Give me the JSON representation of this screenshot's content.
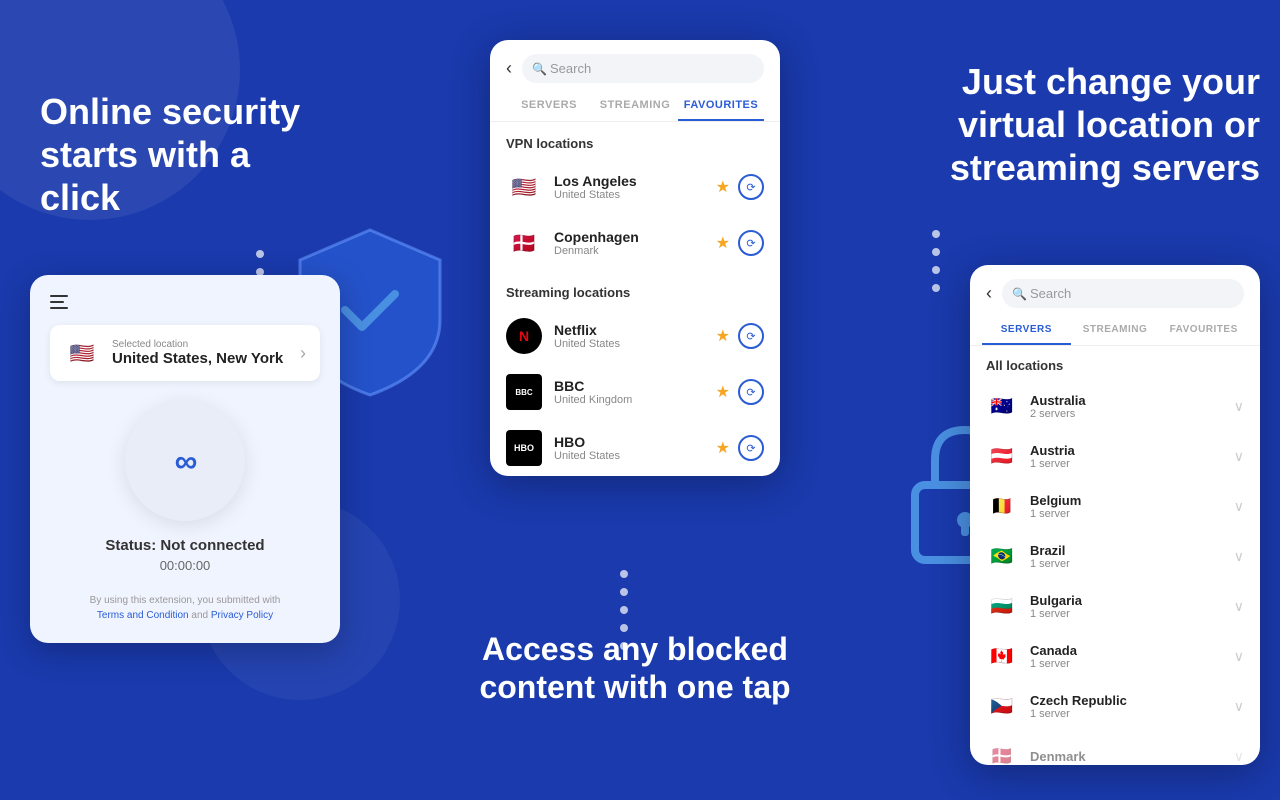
{
  "background": "#1a3aad",
  "left": {
    "headline": "Online security starts with a click",
    "phone": {
      "selected_location_label": "Selected location",
      "selected_location_name": "United States, New York",
      "status": "Status: Not connected",
      "timer": "00:00:00",
      "footer_text": "By using this extension, you submitted with",
      "terms_label": "Terms and Condition",
      "privacy_label": "Privacy Policy",
      "and_text": "and"
    }
  },
  "center_panel": {
    "search_placeholder": "Search",
    "tabs": [
      {
        "label": "SERVERS",
        "active": false
      },
      {
        "label": "STREAMING",
        "active": false
      },
      {
        "label": "FAVOURITES",
        "active": true
      }
    ],
    "vpn_section": "VPN locations",
    "vpn_items": [
      {
        "name": "Los Angeles",
        "sub": "United States",
        "flag": "🇺🇸"
      },
      {
        "name": "Copenhagen",
        "sub": "Denmark",
        "flag": "🇩🇰"
      }
    ],
    "streaming_section": "Streaming locations",
    "streaming_items": [
      {
        "name": "Netflix",
        "sub": "United States",
        "type": "netflix"
      },
      {
        "name": "BBC",
        "sub": "United Kingdom",
        "type": "bbc"
      },
      {
        "name": "HBO",
        "sub": "United States",
        "type": "hbo"
      }
    ]
  },
  "center_bottom": {
    "headline": "Access  any blocked content with one tap"
  },
  "right_header": {
    "headline": "Just change your virtual location or streaming servers"
  },
  "right_panel": {
    "search_placeholder": "Search",
    "tabs": [
      {
        "label": "SERVERS",
        "active": true
      },
      {
        "label": "STREAMING",
        "active": false
      },
      {
        "label": "FAVOURITES",
        "active": false
      }
    ],
    "section_title": "All locations",
    "items": [
      {
        "name": "Australia",
        "sub": "2 servers",
        "flag": "🇦🇺"
      },
      {
        "name": "Austria",
        "sub": "1 server",
        "flag": "🇦🇹"
      },
      {
        "name": "Belgium",
        "sub": "1 server",
        "flag": "🇧🇪"
      },
      {
        "name": "Brazil",
        "sub": "1 server",
        "flag": "🇧🇷"
      },
      {
        "name": "Bulgaria",
        "sub": "1 server",
        "flag": "🇧🇬"
      },
      {
        "name": "Canada",
        "sub": "1 server",
        "flag": "🇨🇦"
      },
      {
        "name": "Czech Republic",
        "sub": "1 server",
        "flag": "🇨🇿"
      },
      {
        "name": "Denmark",
        "sub": "",
        "flag": "🇩🇰"
      }
    ]
  }
}
